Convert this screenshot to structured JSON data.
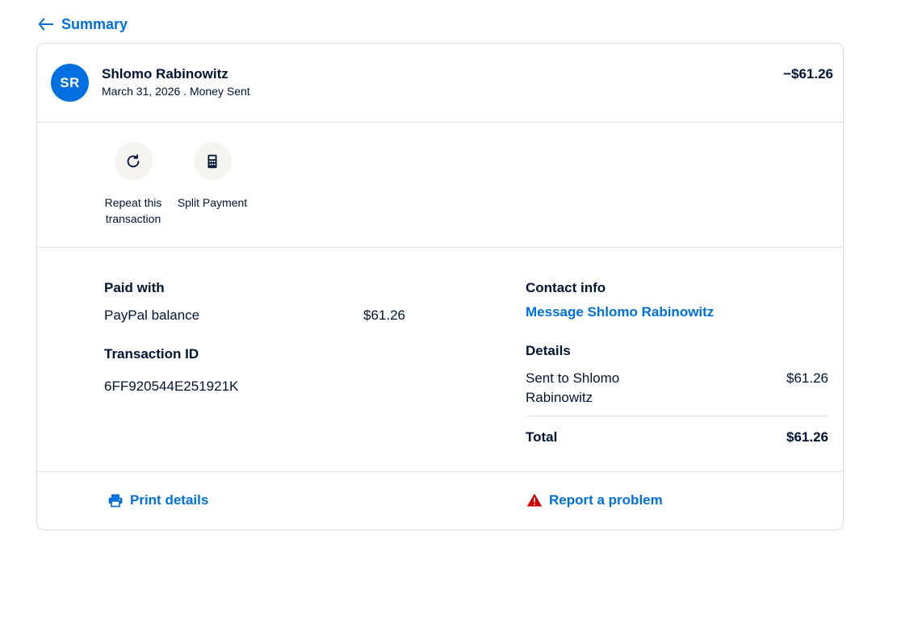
{
  "nav": {
    "back_label": "Summary"
  },
  "header": {
    "avatar_initials": "SR",
    "name": "Shlomo Rabinowitz",
    "subline": "March 31, 2026 . Money Sent",
    "amount": "−$61.26"
  },
  "actions": [
    {
      "label": "Repeat this transaction",
      "icon": "refresh-icon"
    },
    {
      "label": "Split Payment",
      "icon": "calculator-icon"
    }
  ],
  "paid_with": {
    "heading": "Paid with",
    "method": "PayPal balance",
    "amount": "$61.26"
  },
  "transaction": {
    "heading": "Transaction ID",
    "id": "6FF920544E251921K"
  },
  "contact": {
    "heading": "Contact info",
    "link_label": "Message Shlomo Rabinowitz"
  },
  "details": {
    "heading": "Details",
    "line_label_1": "Sent to Shlomo",
    "line_label_2": "Rabinowitz",
    "line_amount": "$61.26",
    "total_label": "Total",
    "total_amount": "$61.26"
  },
  "footer": {
    "print_label": "Print details",
    "report_label": "Report a problem"
  },
  "colors": {
    "brand_blue": "#0070e0",
    "text_dark": "#001435",
    "warning_red": "#d20000"
  }
}
